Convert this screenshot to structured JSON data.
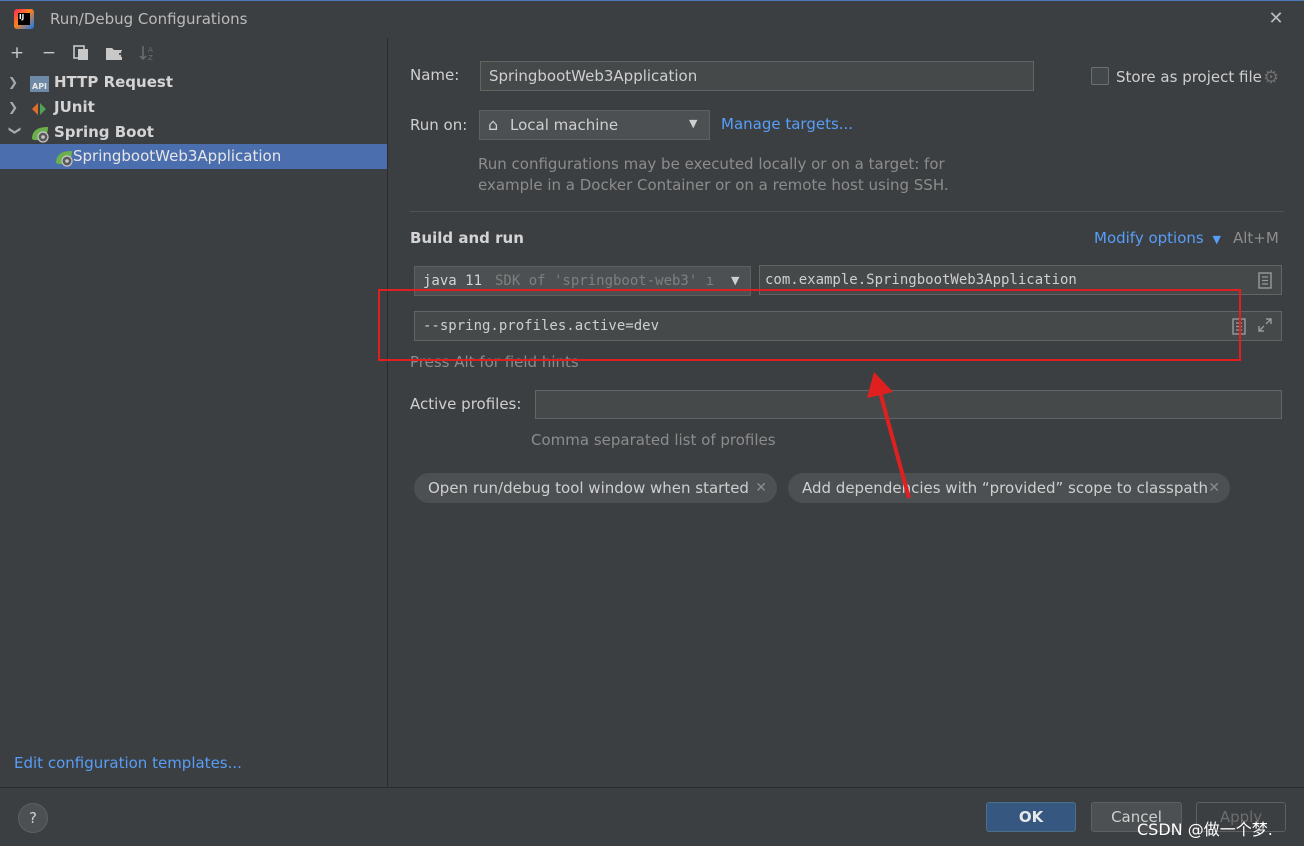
{
  "window": {
    "title": "Run/Debug Configurations",
    "close_icon": "close-icon"
  },
  "toolbar": {
    "add": "+",
    "remove": "−",
    "copy": "copy-icon",
    "folder": "new-folder-icon",
    "sort": "sort-icon"
  },
  "tree": [
    {
      "label": "HTTP Request",
      "icon": "api-icon",
      "expanded": false
    },
    {
      "label": "JUnit",
      "icon": "junit-icon",
      "expanded": false
    },
    {
      "label": "Spring Boot",
      "icon": "spring-boot-icon",
      "expanded": true
    },
    {
      "label": "SpringbootWeb3Application",
      "icon": "spring-app-icon",
      "selected": true
    }
  ],
  "left_footer": {
    "edit_templates": "Edit configuration templates..."
  },
  "form": {
    "name_label": "Name:",
    "name_value": "SpringbootWeb3Application",
    "store_label": "Store as project file",
    "run_on_label": "Run on:",
    "run_on_value": "Local machine",
    "manage_targets": "Manage targets...",
    "run_on_hint_1": "Run configurations may be executed locally or on a target: for",
    "run_on_hint_2": "example in a Docker Container or on a remote host using SSH.",
    "section_title": "Build and run",
    "modify_options": "Modify options",
    "modify_shortcut": "Alt+M",
    "jdk_value": "java 11",
    "jdk_hint": "SDK of 'springboot-web3' ı",
    "main_class": "com.example.SpringbootWeb3Application",
    "program_args": "--spring.profiles.active=dev",
    "field_hint": "Press Alt for field hints",
    "active_profiles_label": "Active profiles:",
    "active_profiles_value": "",
    "profiles_hint": "Comma separated list of profiles",
    "chips": [
      "Open run/debug tool window when started",
      "Add dependencies with “provided” scope to classpath"
    ]
  },
  "buttons": {
    "help": "?",
    "ok": "OK",
    "cancel": "Cancel",
    "apply": "Apply"
  },
  "watermark": "CSDN @做一个梦.",
  "annotation": {
    "highlight_color": "#e02020",
    "arrow_color": "#e02020"
  }
}
